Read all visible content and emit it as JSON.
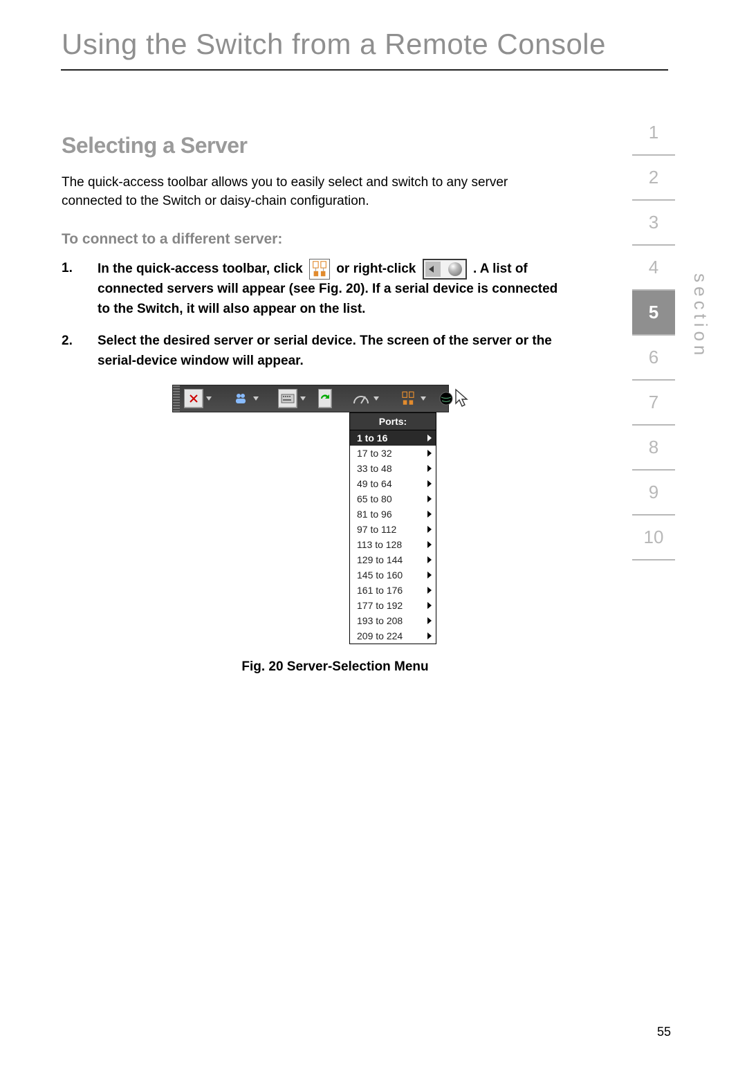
{
  "chapter_title": "Using the Switch from a Remote Console",
  "section_heading": "Selecting a Server",
  "intro": "The quick-access toolbar allows you to easily select and switch to any server connected to the Switch or daisy-chain configuration.",
  "sub_heading": "To connect to a different server:",
  "steps": {
    "one_a": "In the quick-access toolbar, click ",
    "one_b": " or right-click ",
    "one_c": " . A list of connected servers will appear (see Fig. 20). If a serial device is connected to the Switch, it will also appear on the list.",
    "two": "Select the desired server or serial device. The screen of the server or the serial-device window will appear."
  },
  "ports_menu": {
    "header": "Ports:",
    "items": [
      {
        "label": "1 to 16",
        "active": true
      },
      {
        "label": "17 to 32",
        "active": false
      },
      {
        "label": "33 to 48",
        "active": false
      },
      {
        "label": "49 to 64",
        "active": false
      },
      {
        "label": "65 to 80",
        "active": false
      },
      {
        "label": "81 to 96",
        "active": false
      },
      {
        "label": "97 to 112",
        "active": false
      },
      {
        "label": "113 to 128",
        "active": false
      },
      {
        "label": "129 to 144",
        "active": false
      },
      {
        "label": "145 to 160",
        "active": false
      },
      {
        "label": "161 to 176",
        "active": false
      },
      {
        "label": "177 to 192",
        "active": false
      },
      {
        "label": "193 to 208",
        "active": false
      },
      {
        "label": "209 to 224",
        "active": false
      }
    ]
  },
  "fig_caption": "Fig. 20 Server-Selection Menu",
  "section_nav": {
    "label": "section",
    "items": [
      "1",
      "2",
      "3",
      "4",
      "5",
      "6",
      "7",
      "8",
      "9",
      "10"
    ],
    "active_index": 4
  },
  "page_number": "55"
}
